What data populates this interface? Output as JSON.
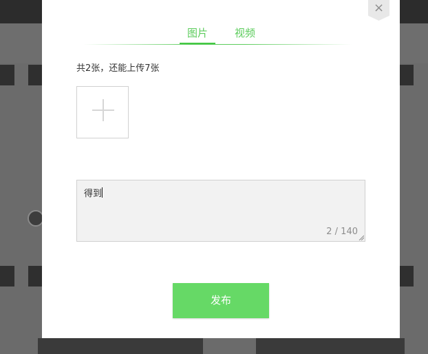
{
  "modal": {
    "close_glyph": "×",
    "tabs": [
      {
        "label": "图片",
        "active": true
      },
      {
        "label": "视频",
        "active": false
      }
    ],
    "upload": {
      "count_text": "共2张，还能上传7张",
      "add_icon": "plus-icon"
    },
    "textarea": {
      "value": "得到",
      "counter": "2 / 140"
    },
    "publish_label": "发布"
  },
  "colors": {
    "accent": "#5ccc5c",
    "button": "#66d966",
    "overlay": "#6b6b6b"
  }
}
